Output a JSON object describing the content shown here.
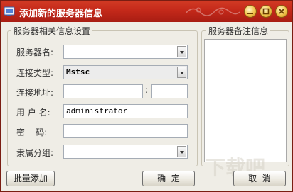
{
  "window": {
    "title": "添加新的服务器信息",
    "colors": {
      "titlebar": "#c4291a",
      "body": "#efede6"
    }
  },
  "server_group": {
    "legend": "服务器相关信息设置",
    "fields": {
      "server_name": {
        "label": "服务器名:",
        "value": ""
      },
      "connection_type": {
        "label": "连接类型:",
        "value": "Mstsc"
      },
      "connection_address": {
        "label": "连接地址:",
        "host": "",
        "separator": ":",
        "port": ""
      },
      "username": {
        "label": "用 户 名:",
        "value": "administrator"
      },
      "password": {
        "label": "密    码:",
        "value": ""
      },
      "group": {
        "label": "隶属分组:",
        "value": ""
      }
    }
  },
  "notes_group": {
    "legend": "服务器备注信息",
    "value": ""
  },
  "buttons": {
    "batch_add": "批量添加",
    "ok": "确  定",
    "cancel": "取  消"
  }
}
